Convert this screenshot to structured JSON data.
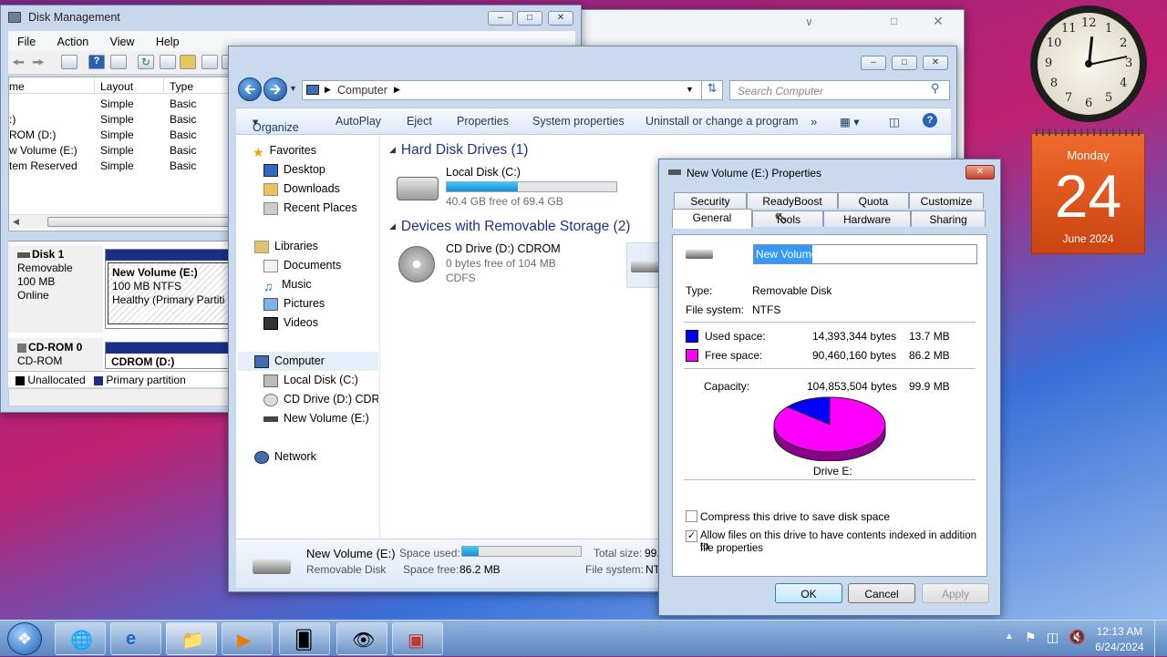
{
  "disk_mgmt": {
    "title": "Disk Management",
    "menu": [
      "File",
      "Action",
      "View",
      "Help"
    ],
    "columns": [
      "me",
      "Layout",
      "Type"
    ],
    "rows": [
      [
        "",
        "Simple",
        "Basic"
      ],
      [
        ":)",
        "Simple",
        "Basic"
      ],
      [
        "ROM (D:)",
        "Simple",
        "Basic"
      ],
      [
        "w Volume (E:)",
        "Simple",
        "Basic"
      ],
      [
        "tem Reserved",
        "Simple",
        "Basic"
      ]
    ],
    "disk1": {
      "name": "Disk 1",
      "kind": "Removable",
      "size": "100 MB",
      "state": "Online",
      "vol_name": "New Volume  (E:)",
      "vol_size": "100 MB NTFS",
      "vol_status": "Healthy (Primary Partitic"
    },
    "cdrom": {
      "name": "CD-ROM 0",
      "kind": "CD-ROM",
      "vol": "CDROM  (D:)"
    },
    "legend": [
      "Unallocated",
      "Primary partition"
    ]
  },
  "explorer": {
    "address": [
      "Computer"
    ],
    "search_placeholder": "Search Computer",
    "commands": [
      "Organize",
      "AutoPlay",
      "Eject",
      "Properties",
      "System properties",
      "Uninstall or change a program",
      "»"
    ],
    "nav": {
      "favorites": "Favorites",
      "fav_items": [
        "Desktop",
        "Downloads",
        "Recent Places"
      ],
      "libraries": "Libraries",
      "lib_items": [
        "Documents",
        "Music",
        "Pictures",
        "Videos"
      ],
      "computer": "Computer",
      "comp_items": [
        "Local Disk (C:)",
        "CD Drive (D:) CDROM",
        "New Volume (E:)"
      ],
      "network": "Network"
    },
    "group_hdd": "Hard Disk Drives (1)",
    "local_disk": {
      "name": "Local Disk (C:)",
      "free": "40.4 GB free of 69.4 GB",
      "used_fraction": 0.42
    },
    "group_removable": "Devices with Removable Storage (2)",
    "cd": {
      "name": "CD Drive (D:) CDROM",
      "free": "0 bytes free of 104 MB",
      "fs": "CDFS"
    },
    "details": {
      "name": "New Volume (E:)",
      "type": "Removable Disk",
      "used_label": "Space used:",
      "free_label": "Space free:",
      "free": "86.2 MB",
      "total_label": "Total size:",
      "total": "99.",
      "fs_label": "File system:",
      "fs": "NT",
      "used_fraction": 0.14
    }
  },
  "props": {
    "title": "New Volume (E:) Properties",
    "tabs_back": [
      "Security",
      "ReadyBoost",
      "Quota",
      "Customize"
    ],
    "tabs_front": [
      "General",
      "Tools",
      "Hardware",
      "Sharing"
    ],
    "volume_label": "New Volume",
    "type_label": "Type:",
    "type": "Removable Disk",
    "fs_label": "File system:",
    "fs": "NTFS",
    "used_label": "Used space:",
    "used_bytes": "14,393,344 bytes",
    "used_mb": "13.7 MB",
    "free_label": "Free space:",
    "free_bytes": "90,460,160 bytes",
    "free_mb": "86.2 MB",
    "cap_label": "Capacity:",
    "cap_bytes": "104,853,504 bytes",
    "cap_mb": "99.9 MB",
    "drive_label": "Drive E:",
    "used_fraction": 0.137,
    "compress": "Compress this drive to save disk space",
    "index1": "Allow files on this drive to have contents indexed in addition to",
    "index2": "file properties",
    "ok": "OK",
    "cancel": "Cancel",
    "apply": "Apply",
    "colors": {
      "used": "#0000ff",
      "free": "#ff00ff"
    }
  },
  "clock": {
    "numbers": [
      "12",
      "1",
      "2",
      "3",
      "4",
      "5",
      "6",
      "7",
      "8",
      "9",
      "10",
      "11"
    ]
  },
  "calendar": {
    "day": "Monday",
    "date": "24",
    "month": "June 2024"
  },
  "tray": {
    "time": "12:13 AM",
    "date": "6/24/2024"
  }
}
